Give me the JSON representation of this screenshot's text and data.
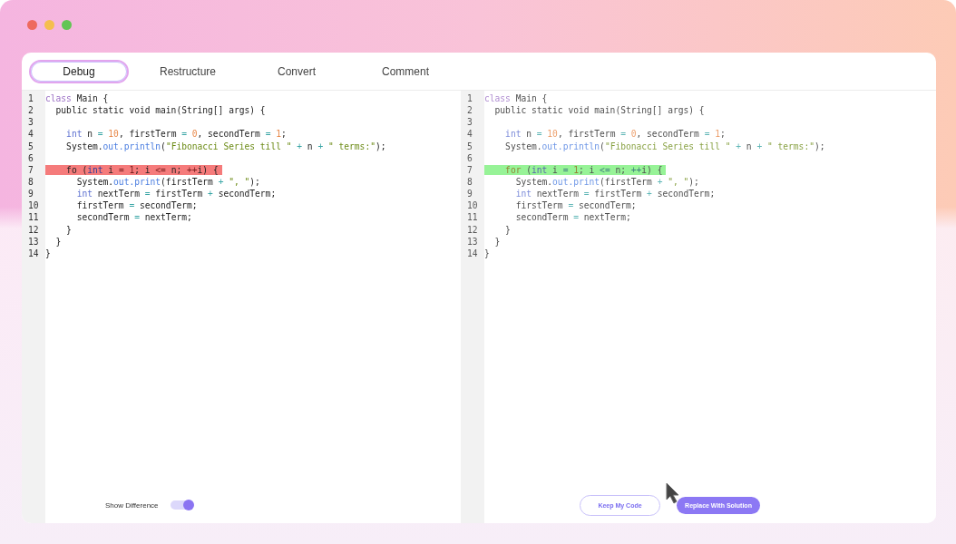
{
  "tabs": [
    {
      "label": "Debug",
      "selected": true
    },
    {
      "label": "Restructure",
      "selected": false
    },
    {
      "label": "Convert",
      "selected": false
    },
    {
      "label": "Comment",
      "selected": false
    }
  ],
  "panels": [
    {
      "dimmed": false,
      "lines": [
        {
          "number": "1",
          "segments": [
            {
              "text": "class",
              "kind": "keyword"
            },
            {
              "text": " Main {",
              "kind": "plain"
            }
          ]
        },
        {
          "number": "2",
          "segments": [
            {
              "text": "  public static void main(String[] args) {",
              "kind": "plain"
            }
          ]
        },
        {
          "number": "3"
        },
        {
          "number": "4",
          "segments": [
            {
              "text": "    int",
              "kind": "type"
            },
            {
              "text": " n ",
              "kind": "plain"
            },
            {
              "text": "= ",
              "kind": "operator"
            },
            {
              "text": "10",
              "kind": "number"
            },
            {
              "text": ", firstTerm ",
              "kind": "plain"
            },
            {
              "text": "= ",
              "kind": "operator"
            },
            {
              "text": "0",
              "kind": "number"
            },
            {
              "text": ", secondTerm ",
              "kind": "plain"
            },
            {
              "text": "= ",
              "kind": "operator"
            },
            {
              "text": "1",
              "kind": "number"
            },
            {
              "text": ";",
              "kind": "plain"
            }
          ]
        },
        {
          "number": "5",
          "segments": [
            {
              "text": "    System.",
              "kind": "plain"
            },
            {
              "text": "out.println",
              "kind": "method"
            },
            {
              "text": "(",
              "kind": "plain"
            },
            {
              "text": "\"Fibonacci Series till \" ",
              "kind": "string"
            },
            {
              "text": "+",
              "kind": "operator"
            },
            {
              "text": " n ",
              "kind": "plain"
            },
            {
              "text": "+ ",
              "kind": "operator"
            },
            {
              "text": "\" terms:\"",
              "kind": "string"
            },
            {
              "text": ");",
              "kind": "plain"
            }
          ]
        },
        {
          "number": "6"
        },
        {
          "number": "7",
          "removed": true,
          "segments": [
            {
              "text": "    fo (",
              "kind": "plain"
            },
            {
              "text": "int",
              "kind": "type"
            },
            {
              "text": " i ",
              "kind": "plain"
            },
            {
              "text": "= ",
              "kind": "operator"
            },
            {
              "text": "1",
              "kind": "number"
            },
            {
              "text": "; i ",
              "kind": "plain"
            },
            {
              "text": "<=",
              "kind": "operator"
            },
            {
              "text": " n; ",
              "kind": "plain"
            },
            {
              "text": "++",
              "kind": "operator"
            },
            {
              "text": "i) {",
              "kind": "plain"
            }
          ]
        },
        {
          "number": "8",
          "segments": [
            {
              "text": "      System.",
              "kind": "plain"
            },
            {
              "text": "out.print",
              "kind": "method"
            },
            {
              "text": "(firstTerm ",
              "kind": "plain"
            },
            {
              "text": "+ ",
              "kind": "operator"
            },
            {
              "text": "\", \"",
              "kind": "string"
            },
            {
              "text": ");",
              "kind": "plain"
            }
          ]
        },
        {
          "number": "9",
          "segments": [
            {
              "text": "      int",
              "kind": "type"
            },
            {
              "text": " nextTerm ",
              "kind": "plain"
            },
            {
              "text": "=",
              "kind": "operator"
            },
            {
              "text": " firstTerm ",
              "kind": "plain"
            },
            {
              "text": "+",
              "kind": "operator"
            },
            {
              "text": " secondTerm;",
              "kind": "plain"
            }
          ]
        },
        {
          "number": "10",
          "segments": [
            {
              "text": "      firstTerm ",
              "kind": "plain"
            },
            {
              "text": "=",
              "kind": "operator"
            },
            {
              "text": " secondTerm;",
              "kind": "plain"
            }
          ]
        },
        {
          "number": "11",
          "segments": [
            {
              "text": "      secondTerm ",
              "kind": "plain"
            },
            {
              "text": "=",
              "kind": "operator"
            },
            {
              "text": " nextTerm;",
              "kind": "plain"
            }
          ]
        },
        {
          "number": "12",
          "segments": [
            {
              "text": "    }",
              "kind": "plain"
            }
          ]
        },
        {
          "number": "13",
          "segments": [
            {
              "text": "  }",
              "kind": "plain"
            }
          ]
        },
        {
          "number": "14",
          "segments": [
            {
              "text": "}",
              "kind": "plain"
            }
          ]
        }
      ],
      "toggle": {
        "label": "Show Difference",
        "on": true
      }
    },
    {
      "dimmed": true,
      "lines": [
        {
          "number": "1",
          "segments": [
            {
              "text": "class",
              "kind": "keyword"
            },
            {
              "text": " Main {",
              "kind": "plain"
            }
          ]
        },
        {
          "number": "2",
          "segments": [
            {
              "text": "  public static void main(String[] args) {",
              "kind": "plain"
            }
          ]
        },
        {
          "number": "3"
        },
        {
          "number": "4",
          "segments": [
            {
              "text": "    int",
              "kind": "type"
            },
            {
              "text": " n ",
              "kind": "plain"
            },
            {
              "text": "= ",
              "kind": "operator"
            },
            {
              "text": "10",
              "kind": "number"
            },
            {
              "text": ", firstTerm ",
              "kind": "plain"
            },
            {
              "text": "= ",
              "kind": "operator"
            },
            {
              "text": "0",
              "kind": "number"
            },
            {
              "text": ", secondTerm ",
              "kind": "plain"
            },
            {
              "text": "= ",
              "kind": "operator"
            },
            {
              "text": "1",
              "kind": "number"
            },
            {
              "text": ";",
              "kind": "plain"
            }
          ]
        },
        {
          "number": "5",
          "segments": [
            {
              "text": "    System.",
              "kind": "plain"
            },
            {
              "text": "out.println",
              "kind": "method"
            },
            {
              "text": "(",
              "kind": "plain"
            },
            {
              "text": "\"Fibonacci Series till \" ",
              "kind": "string"
            },
            {
              "text": "+",
              "kind": "operator"
            },
            {
              "text": " n ",
              "kind": "plain"
            },
            {
              "text": "+ ",
              "kind": "operator"
            },
            {
              "text": "\" terms:\"",
              "kind": "string"
            },
            {
              "text": ");",
              "kind": "plain"
            }
          ]
        },
        {
          "number": "6"
        },
        {
          "number": "7",
          "added": true,
          "segments": [
            {
              "text": "    for",
              "kind": "keyword"
            },
            {
              "text": " (",
              "kind": "plain"
            },
            {
              "text": "int",
              "kind": "type"
            },
            {
              "text": " i ",
              "kind": "plain"
            },
            {
              "text": "= ",
              "kind": "operator"
            },
            {
              "text": "1",
              "kind": "number"
            },
            {
              "text": "; i ",
              "kind": "plain"
            },
            {
              "text": "<=",
              "kind": "operator"
            },
            {
              "text": " n; ",
              "kind": "plain"
            },
            {
              "text": "++",
              "kind": "operator"
            },
            {
              "text": "i) {",
              "kind": "plain"
            }
          ]
        },
        {
          "number": "8",
          "segments": [
            {
              "text": "      System.",
              "kind": "plain"
            },
            {
              "text": "out.print",
              "kind": "method"
            },
            {
              "text": "(firstTerm ",
              "kind": "plain"
            },
            {
              "text": "+ ",
              "kind": "operator"
            },
            {
              "text": "\", \"",
              "kind": "string"
            },
            {
              "text": ");",
              "kind": "plain"
            }
          ]
        },
        {
          "number": "9",
          "segments": [
            {
              "text": "      int",
              "kind": "type"
            },
            {
              "text": " nextTerm ",
              "kind": "plain"
            },
            {
              "text": "=",
              "kind": "operator"
            },
            {
              "text": " firstTerm ",
              "kind": "plain"
            },
            {
              "text": "+",
              "kind": "operator"
            },
            {
              "text": " secondTerm;",
              "kind": "plain"
            }
          ]
        },
        {
          "number": "10",
          "segments": [
            {
              "text": "      firstTerm ",
              "kind": "plain"
            },
            {
              "text": "=",
              "kind": "operator"
            },
            {
              "text": " secondTerm;",
              "kind": "plain"
            }
          ]
        },
        {
          "number": "11",
          "segments": [
            {
              "text": "      secondTerm ",
              "kind": "plain"
            },
            {
              "text": "=",
              "kind": "operator"
            },
            {
              "text": " nextTerm;",
              "kind": "plain"
            }
          ]
        },
        {
          "number": "12",
          "segments": [
            {
              "text": "    }",
              "kind": "plain"
            }
          ]
        },
        {
          "number": "13",
          "segments": [
            {
              "text": "  }",
              "kind": "plain"
            }
          ]
        },
        {
          "number": "14",
          "segments": [
            {
              "text": "}",
              "kind": "plain"
            }
          ]
        }
      ],
      "buttons": [
        {
          "label": "Keep My Code",
          "kind": "secondary"
        },
        {
          "label": "Replace With Solution",
          "kind": "primary"
        }
      ]
    }
  ]
}
